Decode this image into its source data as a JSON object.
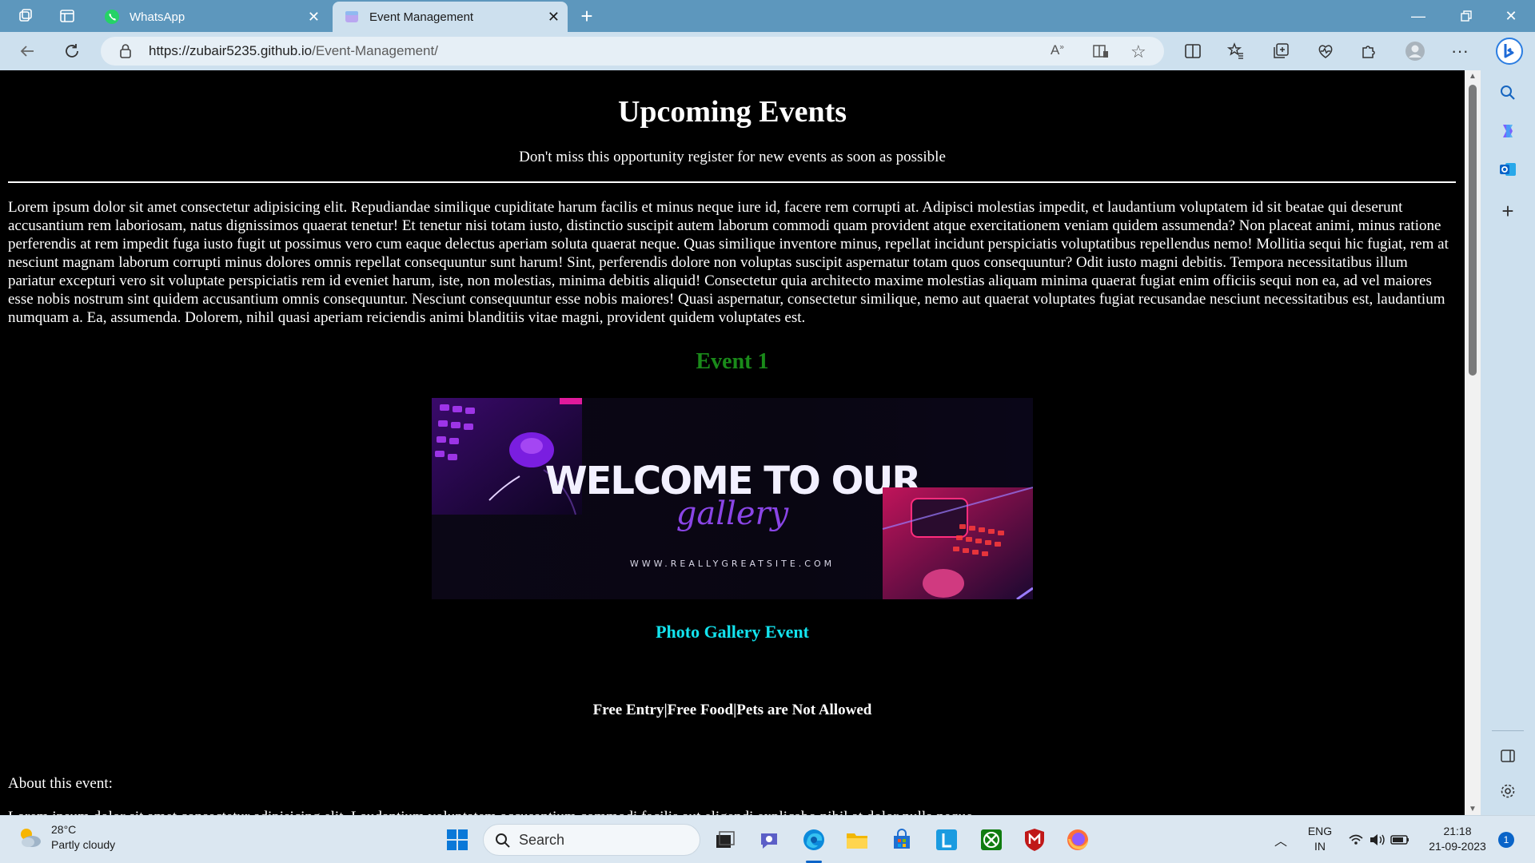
{
  "browser": {
    "tabs": [
      {
        "label": "WhatsApp",
        "icon": "whatsapp-icon",
        "active": false
      },
      {
        "label": "Event Management",
        "icon": "site-icon",
        "active": true
      }
    ],
    "url_host": "https://zubair5235.github.io",
    "url_path": "/Event-Management/"
  },
  "page": {
    "title": "Upcoming Events",
    "subtitle": "Don't miss this opportunity register for new events as soon as possible",
    "intro": "Lorem ipsum dolor sit amet consectetur adipisicing elit. Repudiandae similique cupiditate harum facilis et minus neque iure id, facere rem corrupti at. Adipisci molestias impedit, et laudantium voluptatem id sit beatae qui deserunt accusantium rem laboriosam, natus dignissimos quaerat tenetur! Et tenetur nisi totam iusto, distinctio suscipit autem laborum commodi quam provident atque exercitationem veniam quidem assumenda? Non placeat animi, minus ratione perferendis at rem impedit fuga iusto fugit ut possimus vero cum eaque delectus aperiam soluta quaerat neque. Quas similique inventore minus, repellat incidunt perspiciatis voluptatibus repellendus nemo! Mollitia sequi hic fugiat, rem at nesciunt magnam laborum corrupti minus dolores omnis repellat consequuntur sunt harum! Sint, perferendis dolore non voluptas suscipit aspernatur totam quos consequuntur? Odit iusto magni debitis. Tempora necessitatibus illum pariatur excepturi vero sit voluptate perspiciatis rem id eveniet harum, iste, non molestias, minima debitis aliquid! Consectetur quia architecto maxime molestias aliquam minima quaerat fugiat enim officiis sequi non ea, ad vel maiores esse nobis nostrum sint quidem accusantium omnis consequuntur. Nesciunt consequuntur esse nobis maiores! Quasi aspernatur, consectetur similique, nemo aut quaerat voluptates fugiat recusandae nesciunt necessitatibus est, laudantium numquam a. Ea, assumenda. Dolorem, nihil quasi aperiam reiciendis animi blanditiis vitae magni, provident quidem voluptates est.",
    "event_title": "Event 1",
    "banner": {
      "headline": "WELCOME TO OUR",
      "script": "gallery",
      "site": "WWW.REALLYGREATSITE.COM"
    },
    "gallery_title": "Photo Gallery Event",
    "features": "Free Entry|Free Food|Pets are Not Allowed",
    "about_label": "About this event:",
    "cut_text": "Lorem ipsum dolor sit amet consectetur adipisicing elit. Laudantium voluptatem accusantium commodi facilis aut eligendi explicabo nihil at dolor nulla neque."
  },
  "taskbar": {
    "weather_temp": "28°C",
    "weather_desc": "Partly cloudy",
    "search_label": "Search",
    "lang_top": "ENG",
    "lang_bottom": "IN",
    "time": "21:18",
    "date": "21-09-2023",
    "notif_count": "1"
  },
  "colors": {
    "chrome_tabbar": "#5d97bd",
    "chrome_toolbar": "#cde0ee",
    "event_title": "#1a8a1a",
    "gallery_title": "#13e3ee",
    "page_bg": "#000000"
  }
}
